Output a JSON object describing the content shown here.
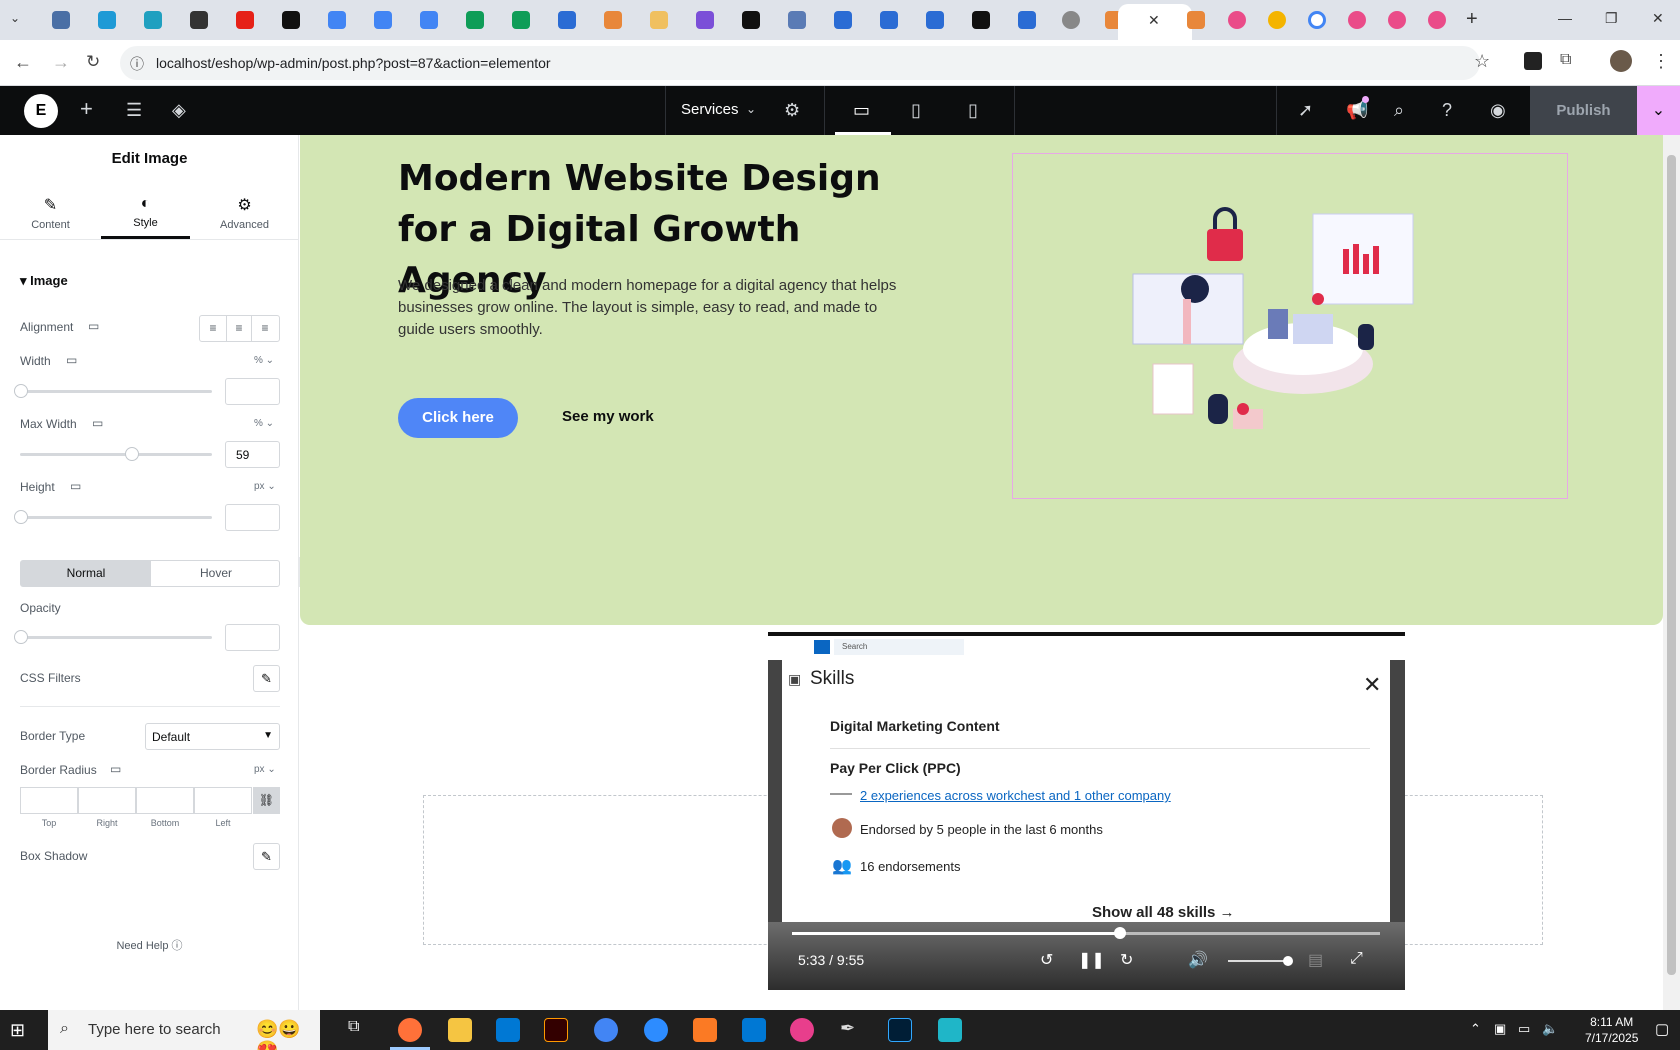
{
  "browser": {
    "url": "localhost/eshop/wp-admin/post.php?post=87&action=elementor"
  },
  "elementor": {
    "page_name": "Services",
    "publish_label": "Publish"
  },
  "panel": {
    "title": "Edit Image",
    "tabs": [
      "Content",
      "Style",
      "Advanced"
    ],
    "active_tab": "Style",
    "section": "Image",
    "alignment_label": "Alignment",
    "width_label": "Width",
    "width_unit": "%",
    "width_value": "",
    "max_width_label": "Max Width",
    "max_width_unit": "%",
    "max_width_value": "59",
    "height_label": "Height",
    "height_unit": "px",
    "height_value": "",
    "normal_label": "Normal",
    "hover_label": "Hover",
    "opacity_label": "Opacity",
    "css_filters_label": "CSS Filters",
    "border_type_label": "Border Type",
    "border_type_value": "Default",
    "border_radius_label": "Border Radius",
    "border_radius_unit": "px",
    "radius_labels": [
      "Top",
      "Right",
      "Bottom",
      "Left"
    ],
    "box_shadow_label": "Box Shadow",
    "need_help": "Need Help"
  },
  "hero": {
    "title": "Modern Website Design for a Digital Growth Agency",
    "description": "We designed a clean and modern homepage for a digital agency that helps businesses grow online. The layout is simple, easy to read, and made to guide users smoothly.",
    "primary_button": "Click here",
    "secondary_button": "See my work"
  },
  "video": {
    "search_placeholder": "Search",
    "card_title": "Skills",
    "item_1": "Digital Marketing Content",
    "item_2": "Pay Per Click (PPC)",
    "experience_link": "2 experiences across workchest and 1 other company",
    "endorsed": "Endorsed by 5 people in the last 6 months",
    "endorsements": "16 endorsements",
    "show_all": "Show all 48 skills →",
    "time": "5:33 / 9:55",
    "progress_fraction": 0.558
  },
  "taskbar": {
    "search_placeholder": "Type here to search",
    "time": "8:11 AM",
    "date": "7/17/2025"
  },
  "colors": {
    "hero_bg": "#d3e6b4",
    "primary_button": "#4f86f7",
    "elementor_dark": "#0c0d0e",
    "publish_accent": "#f0abfc"
  }
}
